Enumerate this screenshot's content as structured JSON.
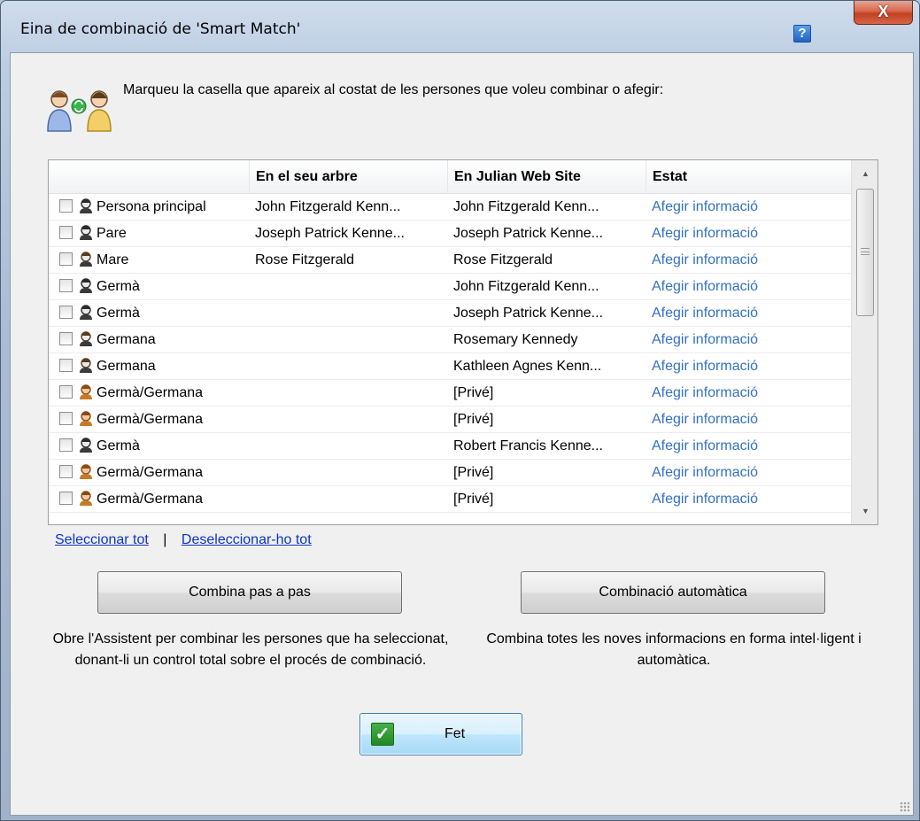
{
  "window": {
    "title": "Eina de combinació de 'Smart Match'",
    "help_label": "?",
    "close_label": "X"
  },
  "instruction": "Marqueu la casella que apareix al costat de les persones que voleu combinar o afegir:",
  "table": {
    "columns": [
      "",
      "En el seu arbre",
      "En Julian Web Site",
      "Estat"
    ],
    "rows": [
      {
        "person": "Persona principal",
        "icon": "male-person-icon",
        "tree": "John Fitzgerald Kenn...",
        "web": "John Fitzgerald Kenn...",
        "status": "Afegir informació",
        "checked": false
      },
      {
        "person": "Pare",
        "icon": "male-person-icon",
        "tree": "Joseph Patrick Kenne...",
        "web": "Joseph Patrick Kenne...",
        "status": "Afegir informació",
        "checked": false
      },
      {
        "person": "Mare",
        "icon": "female-person-icon",
        "tree": "Rose Fitzgerald",
        "web": "Rose Fitzgerald",
        "status": "Afegir informació",
        "checked": false
      },
      {
        "person": "Germà",
        "icon": "male-person-icon",
        "tree": "",
        "web": "John Fitzgerald Kenn...",
        "status": "Afegir informació",
        "checked": false
      },
      {
        "person": "Germà",
        "icon": "male-person-icon",
        "tree": "",
        "web": "Joseph Patrick Kenne...",
        "status": "Afegir informació",
        "checked": false
      },
      {
        "person": "Germana",
        "icon": "female-person-icon",
        "tree": "",
        "web": "Rosemary Kennedy",
        "status": "Afegir informació",
        "checked": false
      },
      {
        "person": "Germana",
        "icon": "female-person-icon",
        "tree": "",
        "web": "Kathleen Agnes Kenn...",
        "status": "Afegir informació",
        "checked": false
      },
      {
        "person": "Germà/Germana",
        "icon": "unknown-person-icon",
        "tree": "",
        "web": "[Privé]",
        "status": "Afegir informació",
        "checked": false
      },
      {
        "person": "Germà/Germana",
        "icon": "unknown-person-icon",
        "tree": "",
        "web": "[Privé]",
        "status": "Afegir informació",
        "checked": false
      },
      {
        "person": "Germà",
        "icon": "male-person-icon",
        "tree": "",
        "web": "Robert Francis Kenne...",
        "status": "Afegir informació",
        "checked": false
      },
      {
        "person": "Germà/Germana",
        "icon": "unknown-person-icon",
        "tree": "",
        "web": "[Privé]",
        "status": "Afegir informació",
        "checked": false
      },
      {
        "person": "Germà/Germana",
        "icon": "unknown-person-icon",
        "tree": "",
        "web": "[Privé]",
        "status": "Afegir informació",
        "checked": false
      }
    ]
  },
  "links": {
    "select_all": "Seleccionar tot",
    "separator": "|",
    "deselect_all": "Deseleccionar-ho tot"
  },
  "actions": {
    "step_label": "Combina pas a pas",
    "step_desc": "Obre l'Assistent per combinar les persones que ha seleccionat, donant-li un control total sobre el procés de combinació.",
    "auto_label": "Combinació automàtica",
    "auto_desc": "Combina totes les noves informacions en forma intel·ligent i automàtica.",
    "done_label": "Fet"
  },
  "colors": {
    "link": "#0c35c8",
    "status": "#3371c4",
    "close": "#c2401f"
  }
}
